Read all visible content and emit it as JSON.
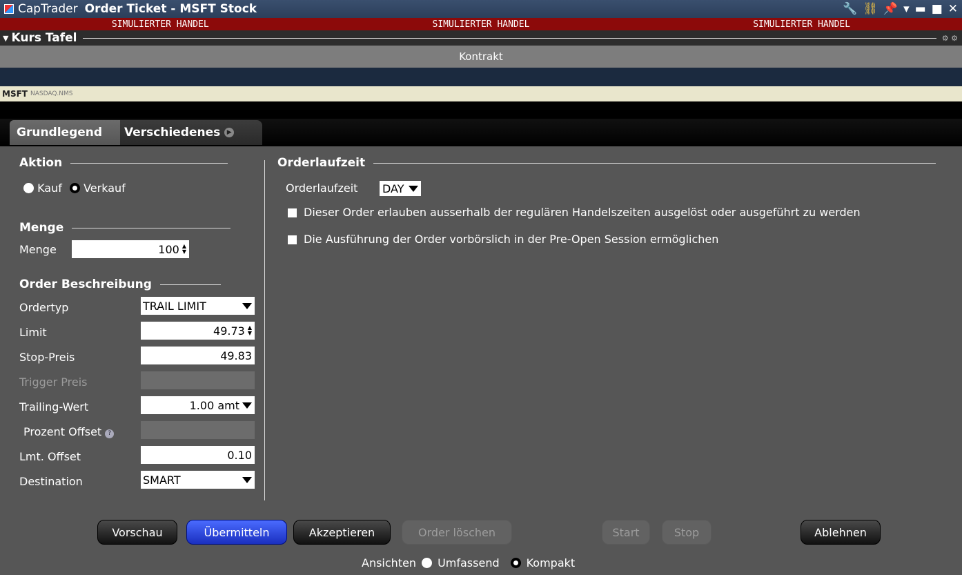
{
  "window": {
    "app_name": "CapTrader",
    "title": "Order Ticket - MSFT Stock",
    "sim_banner": [
      "SIMULIERTER HANDEL",
      "SIMULIERTER HANDEL",
      "SIMULIERTER HANDEL"
    ]
  },
  "quote_panel": {
    "title": "Kurs Tafel",
    "column_header": "Kontrakt",
    "symbol": "MSFT",
    "exchange": "NASDAQ.NMS"
  },
  "tabs": [
    {
      "label": "Grundlegend",
      "active": true
    },
    {
      "label": "Verschiedenes",
      "active": false
    }
  ],
  "action": {
    "heading": "Aktion",
    "buy_label": "Kauf",
    "sell_label": "Verkauf",
    "selected": "Verkauf"
  },
  "quantity": {
    "heading": "Menge",
    "label": "Menge",
    "value": "100"
  },
  "order_description": {
    "heading": "Order Beschreibung",
    "order_type_label": "Ordertyp",
    "order_type_value": "TRAIL LIMIT",
    "limit_label": "Limit",
    "limit_value": "49.73",
    "stop_price_label": "Stop-Preis",
    "stop_price_value": "49.83",
    "trigger_price_label": "Trigger Preis",
    "trailing_label": "Trailing-Wert",
    "trailing_value": "1.00 amt",
    "percent_offset_label": "Prozent Offset",
    "lmt_offset_label": "Lmt. Offset",
    "lmt_offset_value": "0.10",
    "destination_label": "Destination",
    "destination_value": "SMART"
  },
  "time_in_force": {
    "heading": "Orderlaufzeit",
    "label": "Orderlaufzeit",
    "value": "DAY",
    "outside_rth_label": "Dieser Order erlauben ausserhalb der regulären Handelszeiten ausgelöst oder ausgeführt zu werden",
    "pre_open_label": "Die Ausführung der Order vorbörslich in der Pre-Open Session ermöglichen"
  },
  "buttons": {
    "preview": "Vorschau",
    "transmit": "Übermitteln",
    "accept": "Akzeptieren",
    "delete_order": "Order löschen",
    "start": "Start",
    "stop": "Stop",
    "reject": "Ablehnen"
  },
  "views": {
    "label": "Ansichten",
    "full": "Umfassend",
    "compact": "Kompakt",
    "selected": "Kompakt"
  }
}
